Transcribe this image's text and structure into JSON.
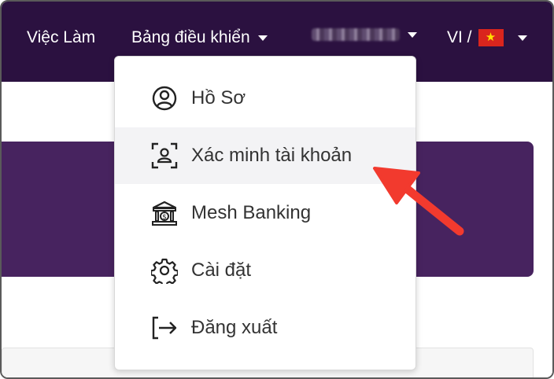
{
  "nav": {
    "jobs_label": "Việc Làm",
    "dashboard_label": "Bảng điều khiển",
    "language_label": "VI /"
  },
  "menu": {
    "items": [
      {
        "label": "Hồ Sơ",
        "icon": "profile-icon"
      },
      {
        "label": "Xác minh tài khoản",
        "icon": "account-verify-icon"
      },
      {
        "label": "Mesh Banking",
        "icon": "bank-icon"
      },
      {
        "label": "Cài đặt",
        "icon": "gear-icon"
      },
      {
        "label": "Đăng xuất",
        "icon": "logout-icon"
      }
    ]
  },
  "colors": {
    "nav_bg": "#2b1140",
    "banner_bg": "#47235f",
    "annotation_arrow": "#f23a2e"
  }
}
